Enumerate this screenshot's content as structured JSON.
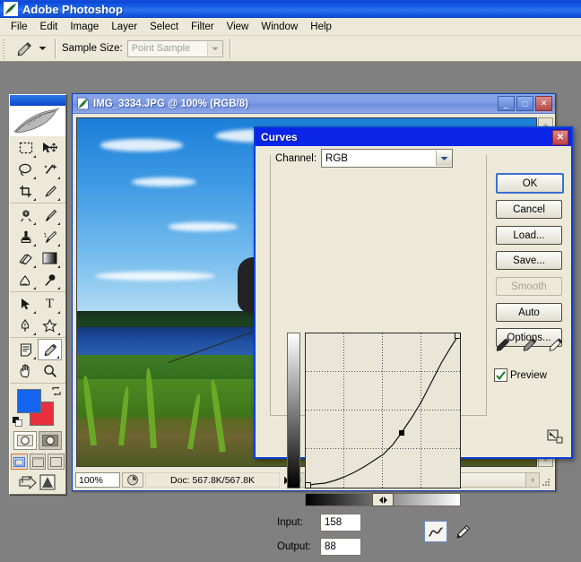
{
  "app": {
    "title": "Adobe Photoshop",
    "logo_icon": "photoshop-feather-icon"
  },
  "menubar": {
    "items": [
      {
        "label": "File"
      },
      {
        "label": "Edit"
      },
      {
        "label": "Image"
      },
      {
        "label": "Layer"
      },
      {
        "label": "Select"
      },
      {
        "label": "Filter"
      },
      {
        "label": "View"
      },
      {
        "label": "Window"
      },
      {
        "label": "Help"
      }
    ]
  },
  "options_bar": {
    "active_tool_icon": "eyedropper-icon",
    "tool_preset_arrow_icon": "chevron-down-icon",
    "sample_size_label": "Sample Size:",
    "sample_size_value": "Point Sample",
    "sample_size_arrow_icon": "chevron-down-icon"
  },
  "toolbox": {
    "tools": [
      {
        "name": "rectangular-marquee",
        "glyph": "marquee"
      },
      {
        "name": "move",
        "glyph": "move"
      },
      {
        "name": "lasso",
        "glyph": "lasso"
      },
      {
        "name": "magic-wand",
        "glyph": "wand"
      },
      {
        "name": "crop",
        "glyph": "crop"
      },
      {
        "name": "slice",
        "glyph": "slice"
      },
      {
        "name": "healing-brush",
        "glyph": "heal"
      },
      {
        "name": "brush",
        "glyph": "brush"
      },
      {
        "name": "clone-stamp",
        "glyph": "stamp"
      },
      {
        "name": "history-brush",
        "glyph": "historybrush"
      },
      {
        "name": "eraser",
        "glyph": "eraser"
      },
      {
        "name": "gradient",
        "glyph": "gradient"
      },
      {
        "name": "blur",
        "glyph": "blur"
      },
      {
        "name": "dodge",
        "glyph": "dodge"
      },
      {
        "name": "path-selection",
        "glyph": "pathsel"
      },
      {
        "name": "type",
        "glyph": "type"
      },
      {
        "name": "pen",
        "glyph": "pen"
      },
      {
        "name": "custom-shape",
        "glyph": "shape"
      },
      {
        "name": "notes",
        "glyph": "notes"
      },
      {
        "name": "eyedropper",
        "glyph": "eyedropper",
        "selected": true
      },
      {
        "name": "hand",
        "glyph": "hand"
      },
      {
        "name": "zoom",
        "glyph": "zoom"
      }
    ],
    "foreground_color": "#1565f0",
    "background_color": "#e8303c",
    "swap_colors_icon": "swap-arrows-icon",
    "default_colors_icon": "default-colors-icon",
    "quickmask_standard_icon": "standard-mode-icon",
    "quickmask_mask_icon": "quick-mask-mode-icon",
    "screenmode_standard_icon": "standard-screen-icon",
    "screenmode_full_menu_icon": "full-screen-menubar-icon",
    "screenmode_full_icon": "full-screen-icon",
    "jump_to_imageready_icon": "jump-to-imageready-icon"
  },
  "document_window": {
    "icon": "document-icon",
    "title": "IMG_3334.JPG @ 100% (RGB/8)",
    "minimize_label": "_",
    "maximize_label": "□",
    "close_label": "✕",
    "status": {
      "zoom": "100%",
      "thumbnail_icon": "doc-sizes-icon",
      "doc_info": "Doc: 567.8K/567.8K",
      "expand_arrow_icon": "play-arrow-icon"
    },
    "photo": {
      "description": "fisherman-at-lakeside",
      "sky_color": "#3f9ae4",
      "shirt_color": "#d81f1f",
      "cap_color": "#c9a258",
      "grass_color": "#4d8a22",
      "water_color": "#1f4fa0"
    }
  },
  "curves_dialog": {
    "title": "Curves",
    "close_label": "✕",
    "channel_label": "Channel:",
    "channel_value": "RGB",
    "channel_arrow_icon": "chevron-down-icon",
    "input_label": "Input:",
    "input_value": "158",
    "output_label": "Output:",
    "output_value": "88",
    "curve_tool_icon": "curve-tool-icon",
    "pencil_tool_icon": "pencil-tool-icon",
    "buttons": [
      {
        "label": "OK",
        "style": "default"
      },
      {
        "label": "Cancel",
        "style": "normal"
      },
      {
        "label": "Load...",
        "style": "normal"
      },
      {
        "label": "Save...",
        "style": "normal"
      },
      {
        "label": "Smooth",
        "style": "disabled"
      },
      {
        "label": "Auto",
        "style": "normal"
      },
      {
        "label": "Options...",
        "style": "normal"
      }
    ],
    "eyedroppers": [
      {
        "name": "set-black-point-icon"
      },
      {
        "name": "set-gray-point-icon"
      },
      {
        "name": "set-white-point-icon"
      }
    ],
    "preview_label": "Preview",
    "preview_checked": true,
    "preview_check_icon": "checkmark-icon",
    "resize_icon": "resize-grip-icon"
  },
  "chart_data": {
    "type": "line",
    "title": "Curves - RGB tone curve",
    "xlabel": "Input",
    "ylabel": "Output",
    "xlim": [
      0,
      255
    ],
    "ylim": [
      0,
      255
    ],
    "grid": true,
    "grid_divisions": 4,
    "legend": "none",
    "control_points": [
      {
        "input": 0,
        "output": 0
      },
      {
        "input": 158,
        "output": 88
      },
      {
        "input": 255,
        "output": 255
      }
    ],
    "x": [
      0,
      16,
      32,
      48,
      64,
      80,
      96,
      112,
      128,
      144,
      158,
      176,
      192,
      208,
      224,
      240,
      255
    ],
    "y": [
      0,
      3,
      7,
      12,
      18,
      25,
      33,
      42,
      52,
      68,
      88,
      115,
      143,
      173,
      203,
      231,
      255
    ],
    "annotations": [
      {
        "label": "Input",
        "value": "158"
      },
      {
        "label": "Output",
        "value": "88"
      }
    ]
  }
}
